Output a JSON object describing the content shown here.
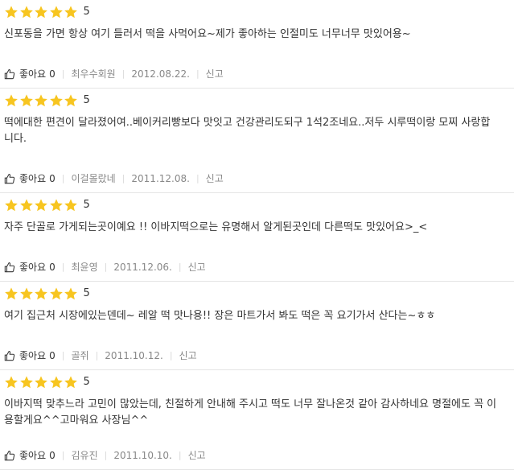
{
  "colors": {
    "star": "#f7c520",
    "separator": "#d9d9d9",
    "meta_text": "#888888",
    "border": "#e5e5e5"
  },
  "icons": {
    "star": "star-icon",
    "like": "thumbs-up-icon"
  },
  "reviews": [
    {
      "rating": 5,
      "score_label": "5",
      "text": "신포동을 가면 항상 여기 들러서 떡을 사먹어요~제가 좋아하는 인절미도 너무너무 맛있어용~",
      "like_label": "좋아요",
      "like_count": "0",
      "author": "최우수회원",
      "date": "2012.08.22.",
      "report_label": "신고"
    },
    {
      "rating": 5,
      "score_label": "5",
      "text": "떡에대한 편견이 달라졌어여..베이커리빵보다 맛잇고 건강관리도되구 1석2조네요..저두 시루떡이랑 모찌 사랑합니다.",
      "like_label": "좋아요",
      "like_count": "0",
      "author": "이걸몰랐네",
      "date": "2011.12.08.",
      "report_label": "신고"
    },
    {
      "rating": 5,
      "score_label": "5",
      "text": "자주 단골로 가게되는곳이예요 !! 이바지떡으로는 유명해서 알게된곳인데 다른떡도 맛있어요>_<",
      "like_label": "좋아요",
      "like_count": "0",
      "author": "최윤영",
      "date": "2011.12.06.",
      "report_label": "신고"
    },
    {
      "rating": 5,
      "score_label": "5",
      "text": "여기 집근처 시장에있는덴데~ 레알 떡 맛나용!! 장은 마트가서 봐도 떡은 꼭 요기가서 산다는~ㅎㅎ",
      "like_label": "좋아요",
      "like_count": "0",
      "author": "골쥐",
      "date": "2011.10.12.",
      "report_label": "신고"
    },
    {
      "rating": 5,
      "score_label": "5",
      "text": "이바지떡 맞추느라 고민이 많았는데, 친절하게 안내해 주시고 떡도 너무 잘나온것 같아 감사하네요 명절에도 꼭 이용할게요^^고마워요 사장님^^",
      "like_label": "좋아요",
      "like_count": "0",
      "author": "김유진",
      "date": "2011.10.10.",
      "report_label": "신고"
    }
  ]
}
